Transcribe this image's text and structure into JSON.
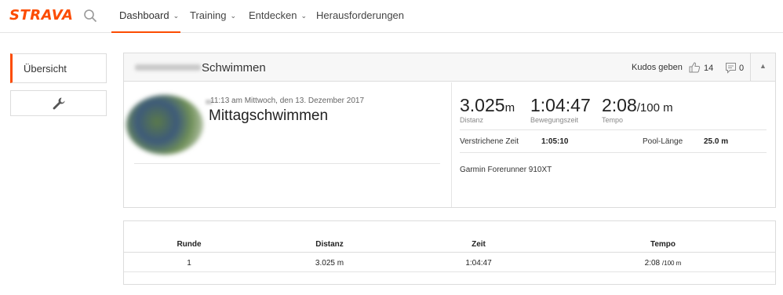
{
  "nav": {
    "logo": "STRAVA",
    "items": [
      {
        "label": "Dashboard",
        "chevron": "⌄"
      },
      {
        "label": "Training",
        "chevron": "⌄"
      },
      {
        "label": "Entdecken",
        "chevron": "⌄"
      },
      {
        "label": "Herausforderungen"
      }
    ]
  },
  "sidebar": {
    "overview_label": "Übersicht",
    "tools_icon": "wrench-icon"
  },
  "activity": {
    "header_title": "Schwimmen",
    "kudos_label": "Kudos geben",
    "kudos_count": "14",
    "comment_count": "0",
    "date": "11:13 am Mittwoch, den 13. Dezember 2017",
    "name": "Mittagschwimmen",
    "stats": [
      {
        "value": "3.025",
        "unit": "m",
        "label": "Distanz"
      },
      {
        "value": "1:04:47",
        "unit": "",
        "label": "Bewegungszeit"
      },
      {
        "value": "2:08",
        "unit": "/100 m",
        "label": "Tempo"
      }
    ],
    "elapsed_label": "Verstrichene Zeit",
    "elapsed_value": "1:05:10",
    "pool_label": "Pool-Länge",
    "pool_value": "25.0 m",
    "device": "Garmin Forerunner 910XT"
  },
  "laps": {
    "headers": [
      "Runde",
      "Distanz",
      "Zeit",
      "Tempo"
    ],
    "rows": [
      {
        "lap": "1",
        "distance": "3.025 m",
        "time": "1:04:47",
        "pace": "2:08",
        "pace_unit": "/100 m"
      }
    ]
  },
  "colors": {
    "brand": "#fc4c02"
  }
}
